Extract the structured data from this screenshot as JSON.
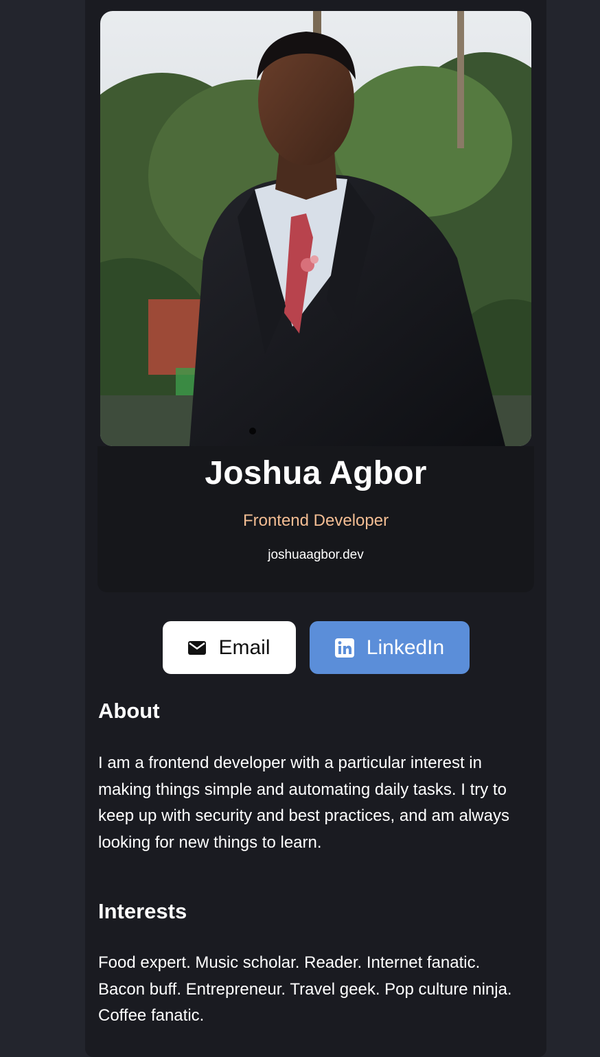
{
  "profile": {
    "name": "Joshua Agbor",
    "title": "Frontend Developer",
    "website": "joshuaagbor.dev"
  },
  "buttons": {
    "email": {
      "label": "Email",
      "icon": "envelope-icon"
    },
    "linkedin": {
      "label": "LinkedIn",
      "icon": "linkedin-icon"
    }
  },
  "about": {
    "heading": "About",
    "text": "I am a frontend developer with a particular interest in making things simple and automating daily tasks. I try to keep up with security and best practices, and am always looking for new things to learn."
  },
  "interests": {
    "heading": "Interests",
    "text": "Food expert. Music scholar. Reader. Internet fanatic. Bacon buff. Entrepreneur. Travel geek. Pop culture ninja. Coffee fanatic."
  },
  "colors": {
    "page_bg": "#23252d",
    "card_bg": "#1a1b21",
    "title_accent": "#f3bd93",
    "linkedin_blue": "#5b8ed9"
  }
}
